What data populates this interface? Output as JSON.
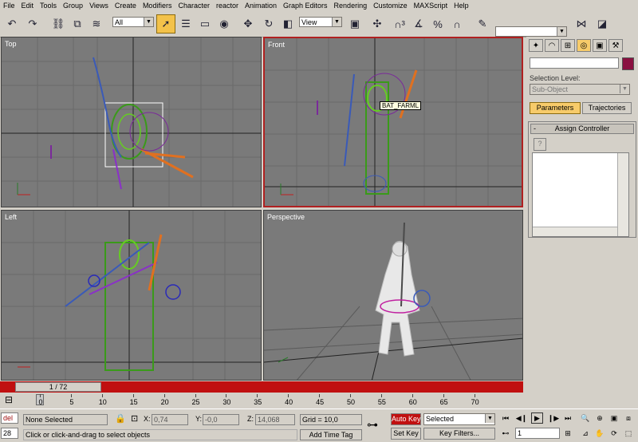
{
  "menu": [
    "File",
    "Edit",
    "Tools",
    "Group",
    "Views",
    "Create",
    "Modifiers",
    "Character",
    "reactor",
    "Animation",
    "Graph Editors",
    "Rendering",
    "Customize",
    "MAXScript",
    "Help"
  ],
  "toolbar": {
    "selection_filter": "All",
    "reference_coord": "View",
    "named_selection": ""
  },
  "viewports": {
    "top": "Top",
    "front": "Front",
    "left": "Left",
    "perspective": "Perspective"
  },
  "tooltip": "BAT_FARML",
  "command_panel": {
    "selection_level_label": "Selection Level:",
    "sub_object": "Sub-Object",
    "tab_parameters": "Parameters",
    "tab_trajectories": "Trajectories",
    "rollout_title": "Assign Controller",
    "rollout_toggle": "-",
    "help_glyph": "?"
  },
  "timeline": {
    "slider": "1 / 72",
    "ticks": [
      "0",
      "5",
      "10",
      "15",
      "20",
      "25",
      "30",
      "35",
      "40",
      "45",
      "50",
      "55",
      "60",
      "65",
      "70"
    ]
  },
  "status": {
    "mini_listener_top": "del",
    "mini_listener_bottom": "28",
    "selection": "None Selected",
    "x_label": "X:",
    "x_value": "0,74",
    "y_label": "Y:",
    "y_value": "-0,0",
    "z_label": "Z:",
    "z_value": "14,068",
    "grid": "Grid = 10,0",
    "prompt": "Click or click-and-drag to select objects",
    "add_time_tag": "Add Time Tag",
    "auto_key": "Auto Key",
    "set_key": "Set Key",
    "key_mode": "Selected",
    "key_filters": "Key Filters...",
    "current_frame": "1"
  },
  "colors": {
    "active_border": "#b02020",
    "timebar": "#c01010",
    "active_button": "#f3c24a",
    "viewport_bg": "#7a7a7a"
  }
}
